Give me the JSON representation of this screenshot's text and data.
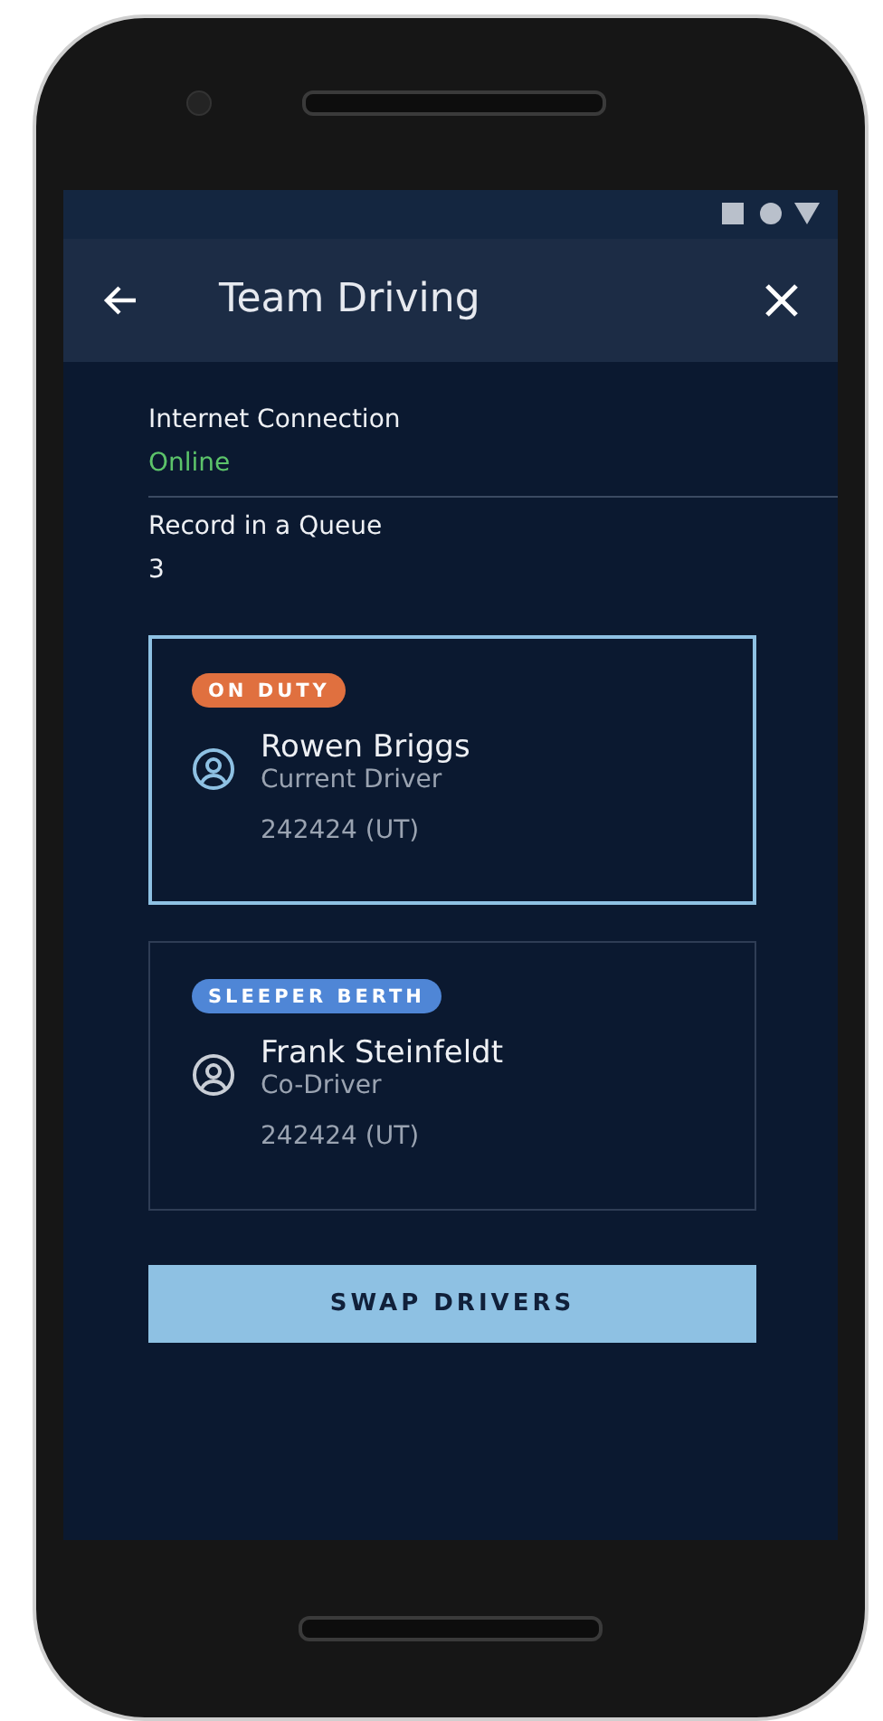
{
  "app_bar": {
    "title": "Team Driving"
  },
  "info": [
    {
      "label": "Internet Connection",
      "value": "Online",
      "kind": "status"
    },
    {
      "label": "Record in a Queue",
      "value": "3",
      "kind": "plain"
    }
  ],
  "drivers": [
    {
      "status": "ON DUTY",
      "color": "#e0703f",
      "name": "Rowen Briggs",
      "role": "Current Driver",
      "code": "242424 (UT)",
      "selected": true
    },
    {
      "status": "SLEEPER BERTH",
      "color": "#4f86d6",
      "name": "Frank Steinfeldt",
      "role": "Co-Driver",
      "code": "242424 (UT)",
      "selected": false
    }
  ],
  "action": {
    "label": "SWAP DRIVERS"
  }
}
